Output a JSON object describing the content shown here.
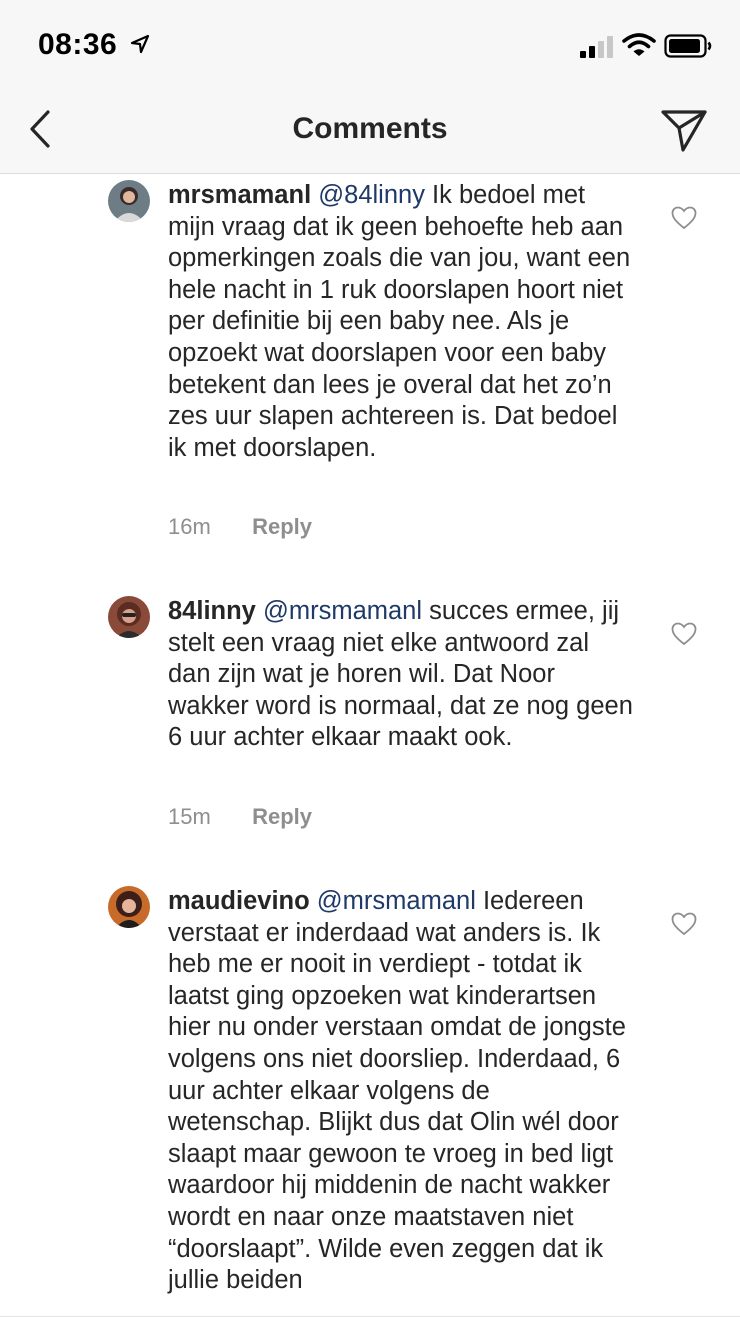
{
  "status_bar": {
    "time": "08:36"
  },
  "header": {
    "title": "Comments"
  },
  "comments": [
    {
      "username": "mrsmamanl",
      "mention": "@84linny",
      "text": " Ik bedoel met mijn vraag dat ik geen behoefte heb aan opmerkingen zoals die van jou, want een hele nacht in 1 ruk doorslapen hoort niet per definitie bij een baby nee. Als je opzoekt wat doorslapen voor een baby betekent dan lees je overal dat het zo’n zes uur slapen achtereen is. Dat bedoel ik met doorslapen.",
      "time": "16m",
      "reply_label": "Reply"
    },
    {
      "username": "84linny",
      "mention": "@mrsmamanl",
      "text": " succes ermee, jij stelt een vraag niet elke antwoord zal dan zijn wat je horen wil. Dat Noor wakker word is normaal, dat ze nog geen 6 uur achter elkaar maakt ook.",
      "time": "15m",
      "reply_label": "Reply"
    },
    {
      "username": "maudievino",
      "mention": "@mrsmamanl",
      "text": " Iedereen verstaat er inderdaad wat anders is. Ik heb me er nooit in verdiept - totdat ik laatst ging opzoeken wat kinderartsen hier nu onder verstaan omdat de jongste volgens ons niet doorsliep. Inderdaad, 6 uur achter elkaar volgens de wetenschap. Blijkt dus dat Olin wél door slaapt maar gewoon te vroeg in bed ligt waardoor hij middenin de nacht wakker wordt en naar onze maatstaven niet “doorslaapt”. Wilde even zeggen dat ik jullie beiden",
      "time": "",
      "reply_label": ""
    }
  ],
  "icons": {
    "back": "chevron-left-icon",
    "share": "paper-plane-icon",
    "like": "heart-outline-icon"
  },
  "colors": {
    "mention": "#1f3a68",
    "meta_gray": "#8e8e8e",
    "header_bg": "#f7f7f7"
  }
}
